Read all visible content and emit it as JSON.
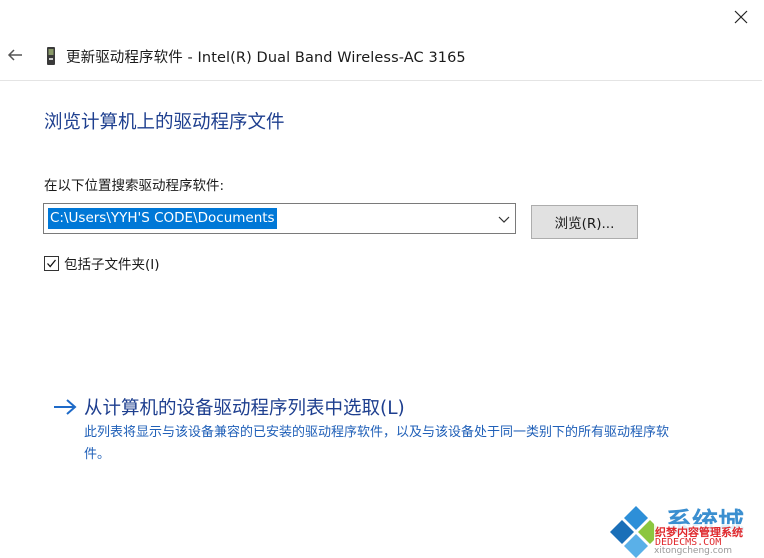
{
  "window": {
    "title": "更新驱动程序软件 - Intel(R) Dual Band Wireless-AC 3165"
  },
  "page": {
    "title": "浏览计算机上的驱动程序文件",
    "search_label": "在以下位置搜索驱动程序软件:",
    "path_value": "C:\\Users\\YYH'S CODE\\Documents",
    "browse_label": "浏览(R)...",
    "include_subfolders": {
      "label": "包括子文件夹(I)",
      "checked": true
    },
    "pick_from_list": {
      "title": "从计算机的设备驱动程序列表中选取(L)",
      "description": "此列表将显示与该设备兼容的已安装的驱动程序软件，以及与该设备处于同一类别下的所有驱动程序软件。"
    }
  },
  "watermark": {
    "brand": "系统城",
    "line1": "织梦内容管理系统",
    "line2": "DEDECMS.COM",
    "url": "xitongcheng.com"
  },
  "colors": {
    "heading": "#1e3f8f",
    "link_desc": "#2060b8",
    "selection": "#0078d7",
    "button_bg": "#e1e1e1"
  }
}
